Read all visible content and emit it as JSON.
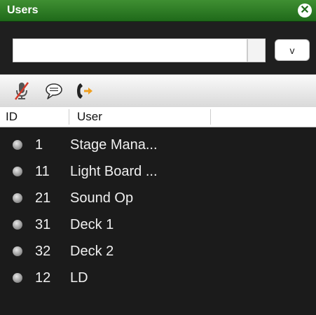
{
  "window": {
    "title": "Users"
  },
  "input": {
    "value": "",
    "button_label": "v"
  },
  "toolbar": {
    "icons": [
      "muted-microphone-icon",
      "chat-bubble-icon",
      "phone-call-icon"
    ]
  },
  "table": {
    "headers": {
      "id": "ID",
      "user": "User"
    },
    "rows": [
      {
        "id": "1",
        "name": "Stage Mana..."
      },
      {
        "id": "11",
        "name": "Light Board ..."
      },
      {
        "id": "21",
        "name": "Sound Op"
      },
      {
        "id": "31",
        "name": "Deck 1"
      },
      {
        "id": "32",
        "name": "Deck 2"
      },
      {
        "id": "12",
        "name": "LD"
      }
    ]
  },
  "colors": {
    "title_bar": "#2e7d24",
    "accent_orange": "#f0a020",
    "mute_red": "#d43b2b"
  }
}
